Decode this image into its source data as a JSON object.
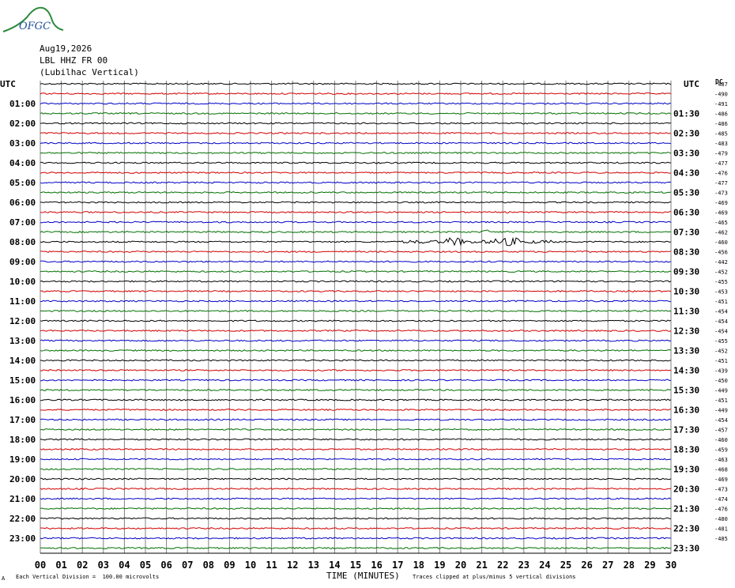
{
  "logo": {
    "text": "OFGC"
  },
  "header": {
    "date": "Aug19,2026",
    "station": "LBL HHZ FR 00",
    "location": "(Lubilhac Vertical)"
  },
  "left_title": "UTC",
  "right_title": "UTC",
  "corner_label": "DC",
  "footer": {
    "scale_note": "Each Vertical Division =  100.00 microvolts",
    "clip_note": "Traces clipped at plus/minus 5 vertical divisions",
    "tiny_mark": "A"
  },
  "colors": {
    "trace_cycle": [
      "#000000",
      "#d40000",
      "#0000c8",
      "#007000"
    ],
    "grid": "#808080",
    "logo": "#2e8b3e"
  },
  "chart_data": {
    "type": "line",
    "title": "",
    "xlabel": "TIME (MINUTES)",
    "ylabel": "",
    "xlim": [
      0,
      30
    ],
    "x_ticks": [
      "00",
      "01",
      "02",
      "03",
      "04",
      "05",
      "06",
      "07",
      "08",
      "09",
      "10",
      "11",
      "12",
      "13",
      "14",
      "15",
      "16",
      "17",
      "18",
      "19",
      "20",
      "21",
      "22",
      "23",
      "24",
      "25",
      "26",
      "27",
      "28",
      "29",
      "30"
    ],
    "trace_count": 48,
    "trace_minutes": 30,
    "left_labels": [
      "01:00",
      "02:00",
      "03:00",
      "04:00",
      "05:00",
      "06:00",
      "07:00",
      "08:00",
      "09:00",
      "10:00",
      "11:00",
      "12:00",
      "13:00",
      "14:00",
      "15:00",
      "16:00",
      "17:00",
      "18:00",
      "19:00",
      "20:00",
      "21:00",
      "22:00",
      "23:00"
    ],
    "right_labels": [
      "01:30",
      "02:30",
      "03:30",
      "04:30",
      "05:30",
      "06:30",
      "07:30",
      "08:30",
      "09:30",
      "10:30",
      "11:30",
      "12:30",
      "13:30",
      "14:30",
      "15:30",
      "16:30",
      "17:30",
      "18:30",
      "19:30",
      "20:30",
      "21:30",
      "22:30",
      "23:30"
    ],
    "dc_offsets": [
      -487,
      -490,
      -491,
      -486,
      -486,
      -485,
      -483,
      -479,
      -477,
      -476,
      -477,
      -473,
      -469,
      -469,
      -465,
      -462,
      -460,
      -456,
      -442,
      -452,
      -455,
      -453,
      -451,
      -454,
      -454,
      -454,
      -455,
      -452,
      -451,
      -439,
      -450,
      -449,
      -451,
      -449,
      -454,
      -457,
      -460,
      -459,
      -463,
      -468,
      -469,
      -473,
      -474,
      -476,
      -480,
      -481,
      -485
    ],
    "events": [
      {
        "trace": 16,
        "start_min": 17.2,
        "end_min": 24.5,
        "amplitude": "moderate"
      },
      {
        "trace": 16,
        "start_min": 19.3,
        "end_min": 20.1,
        "amplitude": "strong"
      },
      {
        "trace": 16,
        "start_min": 21.6,
        "end_min": 22.8,
        "amplitude": "strong"
      },
      {
        "trace": 15,
        "start_min": 21.0,
        "end_min": 21.3,
        "amplitude": "small"
      }
    ],
    "grid": true
  }
}
